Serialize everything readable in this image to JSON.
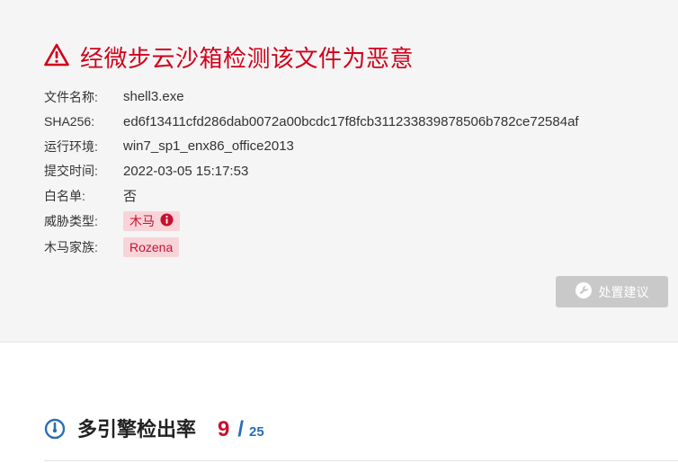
{
  "verdict": {
    "title": "经微步云沙箱检测该文件为恶意",
    "color": "#d0021b"
  },
  "info": {
    "file_name": {
      "label": "文件名称:",
      "value": "shell3.exe"
    },
    "sha256": {
      "label": "SHA256:",
      "value": "ed6f13411cfd286dab0072a00bcdc17f8fcb311233839878506b782ce72584af"
    },
    "environment": {
      "label": "运行环境:",
      "value": "win7_sp1_enx86_office2013"
    },
    "submit_time": {
      "label": "提交时间:",
      "value": "2022-03-05 15:17:53"
    },
    "whitelist": {
      "label": "白名单:",
      "value": "否"
    },
    "threat_type": {
      "label": "威胁类型:",
      "value": "木马",
      "icon": "info-icon"
    },
    "family": {
      "label": "木马家族:",
      "value": "Rozena"
    }
  },
  "actions": {
    "advice_button": "处置建议",
    "advice_icon": "wrench-icon"
  },
  "engines": {
    "title": "多引擎检出率",
    "detected": "9",
    "separator": "/",
    "total": "25",
    "icon": "gauge-icon"
  },
  "colors": {
    "malicious": "#c8102e",
    "tag_bg": "#f8d4d9",
    "accent_blue": "#2a6db5",
    "button_disabled": "#c9c9c9"
  }
}
